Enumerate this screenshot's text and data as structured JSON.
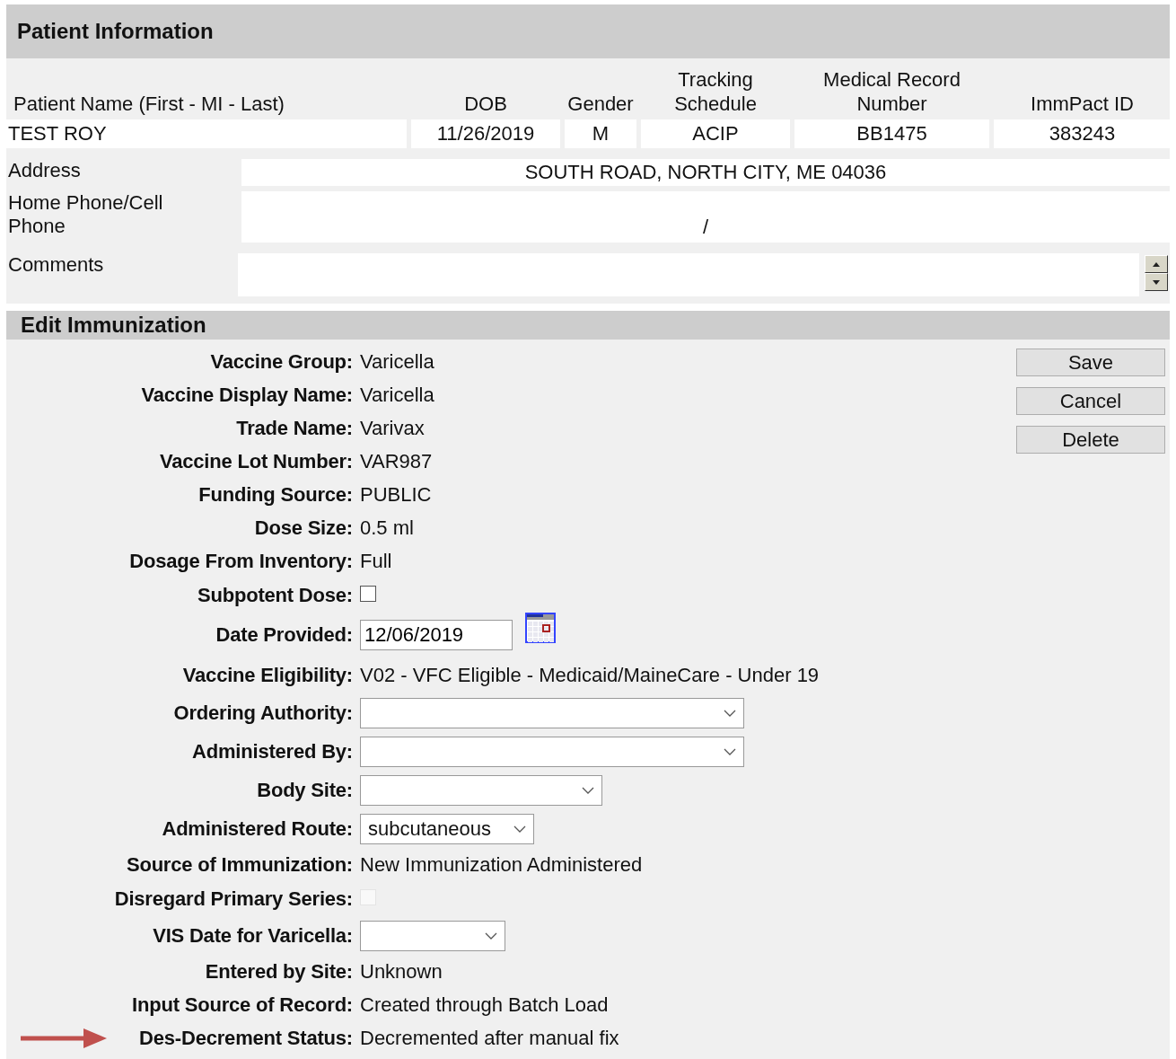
{
  "patient_section": {
    "title": "Patient Information",
    "columns": [
      "Patient Name (First - MI - Last)",
      "DOB",
      "Gender",
      "Tracking Schedule",
      "Medical Record Number",
      "ImmPact ID"
    ],
    "row": [
      "TEST ROY",
      "11/26/2019",
      "M",
      "ACIP",
      "BB1475",
      "383243"
    ],
    "address": {
      "label": "Address",
      "value": "SOUTH ROAD, NORTH CITY, ME 04036"
    },
    "phone": {
      "label": "Home Phone/Cell Phone",
      "value": "/"
    },
    "comments": {
      "label": "Comments"
    }
  },
  "edit_section": {
    "title": "Edit Immunization",
    "fields": [
      {
        "kind": "text",
        "label": "Vaccine Group:",
        "value": "Varicella"
      },
      {
        "kind": "text",
        "label": "Vaccine Display Name:",
        "value": "Varicella"
      },
      {
        "kind": "text",
        "label": "Trade Name:",
        "value": "Varivax"
      },
      {
        "kind": "text",
        "label": "Vaccine Lot Number:",
        "value": "VAR987"
      },
      {
        "kind": "text",
        "label": "Funding Source:",
        "value": "PUBLIC"
      },
      {
        "kind": "text",
        "label": "Dose Size:",
        "value": "0.5 ml"
      },
      {
        "kind": "text",
        "label": "Dosage From Inventory:",
        "value": "Full"
      },
      {
        "kind": "checkbox",
        "label": "Subpotent Dose:",
        "checked": false,
        "disabled": false
      },
      {
        "kind": "date",
        "label": "Date Provided:",
        "value": "12/06/2019"
      },
      {
        "kind": "text",
        "label": "Vaccine Eligibility:",
        "value": "V02 - VFC Eligible - Medicaid/MaineCare - Under 19"
      },
      {
        "kind": "select",
        "label": "Ordering Authority:"
      },
      {
        "kind": "select",
        "label": "Administered By:"
      },
      {
        "kind": "select",
        "label": "Body Site:"
      },
      {
        "kind": "select",
        "label": "Administered Route:",
        "value": "subcutaneous"
      },
      {
        "kind": "text",
        "label": "Source of Immunization:",
        "value": "New Immunization Administered"
      },
      {
        "kind": "checkbox",
        "label": "Disregard Primary Series:",
        "checked": false,
        "disabled": true
      },
      {
        "kind": "select",
        "label": "VIS Date for Varicella:"
      },
      {
        "kind": "text",
        "label": "Entered by Site:",
        "value": "Unknown"
      },
      {
        "kind": "text",
        "label": "Input Source of Record:",
        "value": "Created through Batch Load"
      },
      {
        "kind": "text",
        "label": "Des-Decrement Status:",
        "value": "Decremented after manual fix",
        "marked": true
      }
    ],
    "buttons": [
      "Save",
      "Cancel",
      "Delete"
    ]
  }
}
